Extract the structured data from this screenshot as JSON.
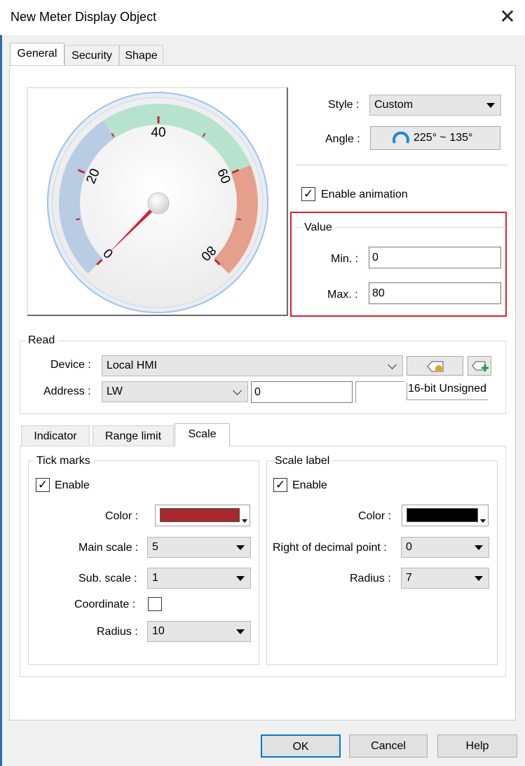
{
  "window": {
    "title": "New Meter Display Object"
  },
  "tabs": [
    "General",
    "Security",
    "Shape"
  ],
  "meter": {
    "scale_labels": [
      "0",
      "20",
      "40",
      "60",
      "80"
    ],
    "min": 0,
    "max": 80,
    "needle_value": 0,
    "band_colors": {
      "low": "#b8cce4",
      "mid": "#b5e3cd",
      "high": "#e4a08c"
    },
    "tick_color": "#c02a35"
  },
  "style": {
    "label": "Style :",
    "value": "Custom"
  },
  "angle": {
    "label": "Angle :",
    "value": "225° ~ 135°"
  },
  "animation": {
    "label": "Enable animation",
    "checked": true
  },
  "value_group": {
    "title": "Value",
    "min_label": "Min. :",
    "min_value": "0",
    "max_label": "Max. :",
    "max_value": "80",
    "highlight_color": "#d9232d"
  },
  "read": {
    "title": "Read",
    "device_label": "Device :",
    "device_value": "Local HMI",
    "address_label": "Address :",
    "address_type": "LW",
    "address_value": "0",
    "data_format": "16-bit Unsigned"
  },
  "subtabs": [
    "Indicator",
    "Range limit",
    "Scale"
  ],
  "tick_marks": {
    "title": "Tick marks",
    "enable_label": "Enable",
    "enabled": true,
    "color_label": "Color :",
    "color": "#a8292b",
    "main_scale_label": "Main scale :",
    "main_scale": "5",
    "sub_scale_label": "Sub. scale :",
    "sub_scale": "1",
    "coordinate_label": "Coordinate :",
    "coordinate": false,
    "radius_label": "Radius :",
    "radius": "10"
  },
  "scale_label": {
    "title": "Scale label",
    "enable_label": "Enable",
    "enabled": true,
    "color_label": "Color :",
    "color": "#000000",
    "decimal_label": "Right of decimal point :",
    "decimal": "0",
    "radius_label": "Radius :",
    "radius": "7"
  },
  "buttons": {
    "ok": "OK",
    "cancel": "Cancel",
    "help": "Help"
  }
}
